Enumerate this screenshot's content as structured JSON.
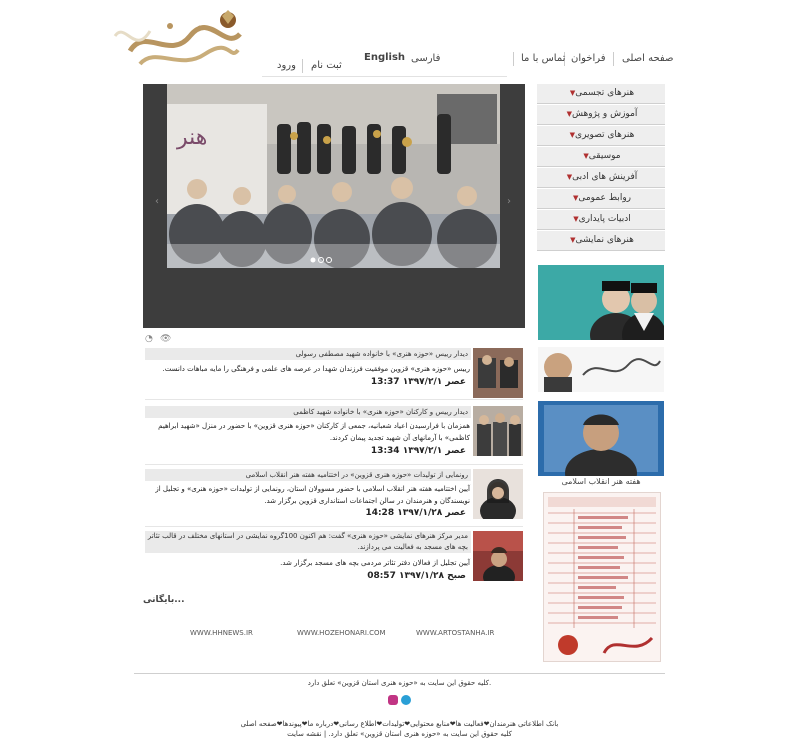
{
  "nav": {
    "home": "صفحه اصلی",
    "calls": "فراخوان",
    "contact": "تماس با ما",
    "farsi": "فارسی",
    "english": "English",
    "register": "ثبت نام",
    "login": "ورود"
  },
  "menu": [
    {
      "label": "هنرهای تجسمی"
    },
    {
      "label": "آموزش و پژوهش"
    },
    {
      "label": "هنرهای تصویری"
    },
    {
      "label": "موسیقی"
    },
    {
      "label": "آفرینش های ادبی"
    },
    {
      "label": "روابط عمومی"
    },
    {
      "label": "ادبیات پایداری"
    },
    {
      "label": "هنرهای نمایشی"
    }
  ],
  "news": [
    {
      "title": "دیدار رییس «حوزه هنری» با خانواده شهید مصطفی رسولی",
      "summary": "رییس «حوزه هنری» قزوین موفقیت فرزندان شهدا در عرصه های علمی و فرهنگی را مایه مباهات دانست.",
      "time": "13:37 عصر ۱۳۹۷/۲/۱"
    },
    {
      "title": "دیدار رییس و کارکنان «حوزه هنری» با خانواده شهید کاظمی",
      "summary": "همزمان با فرارسیدن اعیاد شعبانیه، جمعی از کارکنان «حوزه هنری قزوین» با حضور در منزل «شهید ابراهیم کاظمی» با آرمانهای آن شهید تجدید پیمان کردند.",
      "time": "13:34 عصر ۱۳۹۷/۲/۱"
    },
    {
      "title": "رونمایی از تولیدات «حوزه هنری قزوین» در اختتامیه هفته هنر انقلاب اسلامی",
      "summary": "آیین اختتامیه هفته هنر انقلاب اسلامی با حضور مسوولان استان، رونمایی از تولیدات «حوزه هنری» و تجلیل از نویسندگان و هنرمندان در سالن اجتماعات استانداری قزوین برگزار شد.",
      "time": "14:28 عصر ۱۳۹۷/۱/۲۸"
    },
    {
      "title": "مدیر مرکز هنرهای نمایشی «حوزه هنری» گفت: هم اکنون 100گروه نمایشی در استانهای مختلف در قالب تئاتر بچه های مسجد به فعالیت می پردازند.",
      "summary": "آیین تجلیل از فعالان دفتر تئاتر مردمی بچه های مسجد برگزار شد.",
      "time": "08:57 صبح ۱۳۹۷/۱/۲۸"
    }
  ],
  "archive_label": "بایگانی...",
  "footer_links": [
    "WWW.HHNEWS.IR",
    "WWW.HOZEHONARI.COM",
    "WWW.ARTOSTANHA.IR"
  ],
  "side": {
    "banner_caption": "هفته هنر انقلاب اسلامی"
  },
  "copyright": "کلیه حقوق این سایت به «حوزه هنری استان قزوین» تعلق دارد.",
  "bottom_links": "بانک اطلاعاتی هنرمندان❤فعالیت ها❤منابع محتوایی❤تولیدات❤اطلاع رسانی❤درباره ما❤پیوندها❤صفحه اصلی",
  "bottom_copyright": "کلیه حقوق این سایت به «حوزه هنری استان قزوین» تعلق دارد. | نقشه سایت",
  "colors": {
    "accent_red": "#b03030",
    "menu_bg": "#eeeeee",
    "slider_bg": "#3d3d3d",
    "telegram": "#2a9fd6",
    "instagram": "#c13584"
  }
}
